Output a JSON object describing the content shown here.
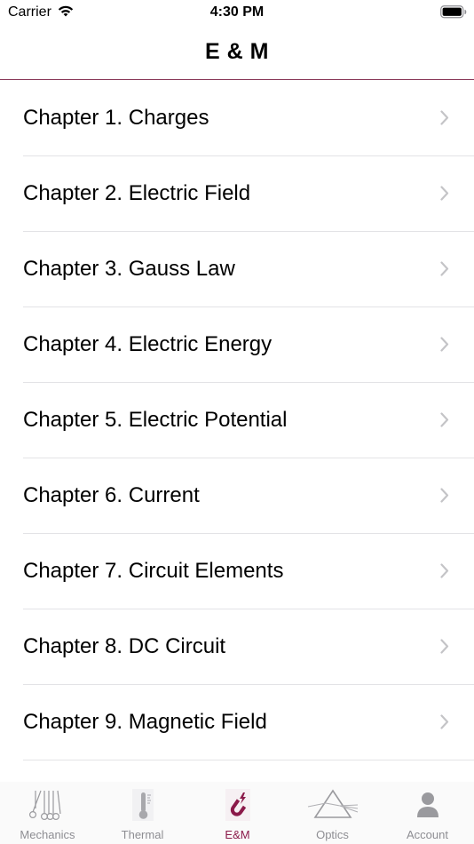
{
  "status_bar": {
    "carrier": "Carrier",
    "time": "4:30 PM"
  },
  "nav": {
    "title": "E & M"
  },
  "chapters": [
    {
      "label": "Chapter 1. Charges"
    },
    {
      "label": "Chapter 2. Electric Field"
    },
    {
      "label": "Chapter 3. Gauss Law"
    },
    {
      "label": "Chapter 4. Electric Energy"
    },
    {
      "label": "Chapter 5. Electric Potential"
    },
    {
      "label": "Chapter 6. Current"
    },
    {
      "label": "Chapter 7. Circuit Elements"
    },
    {
      "label": "Chapter 8. DC Circuit"
    },
    {
      "label": "Chapter 9. Magnetic Field"
    }
  ],
  "tabs": [
    {
      "label": "Mechanics",
      "icon": "newtons-cradle-icon",
      "active": false
    },
    {
      "label": "Thermal",
      "icon": "thermometer-icon",
      "active": false
    },
    {
      "label": "E&M",
      "icon": "magnet-icon",
      "active": true
    },
    {
      "label": "Optics",
      "icon": "prism-icon",
      "active": false
    },
    {
      "label": "Account",
      "icon": "person-icon",
      "active": false
    }
  ],
  "colors": {
    "accent": "#8b1a4a",
    "separator": "#e3e3e6",
    "inactive_tab": "#8e8e93",
    "chevron": "#c4c4c7"
  }
}
